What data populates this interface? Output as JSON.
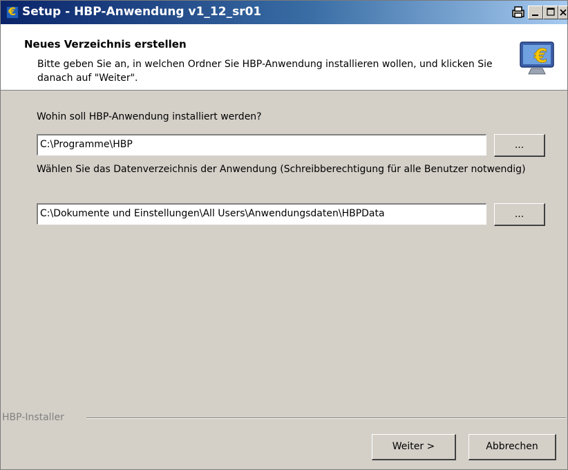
{
  "window": {
    "title": "Setup - HBP-Anwendung v1_12_sr01"
  },
  "header": {
    "title": "Neues Verzeichnis erstellen",
    "description": "Bitte geben Sie an, in welchen Ordner Sie HBP-Anwendung installieren wollen, und klicken Sie danach auf \"Weiter\"."
  },
  "install_dir": {
    "label": "Wohin soll HBP-Anwendung installiert werden?",
    "value": "C:\\Programme\\HBP",
    "browse_label": "..."
  },
  "data_dir": {
    "label": "Wählen Sie das Datenverzeichnis der Anwendung (Schreibberechtigung für alle Benutzer notwendig)",
    "value": "C:\\Dokumente und Einstellungen\\All Users\\Anwendungsdaten\\HBPData",
    "browse_label": "..."
  },
  "footer": {
    "group_label": "HBP-Installer",
    "next_label": "Weiter >",
    "cancel_label": "Abbrechen"
  },
  "icons": {
    "app": "euro-app-icon",
    "header": "euro-monitor-icon"
  },
  "colors": {
    "titlebar_start": "#0a246a",
    "titlebar_end": "#a6caf0",
    "dialog_bg": "#d4d0c8"
  }
}
